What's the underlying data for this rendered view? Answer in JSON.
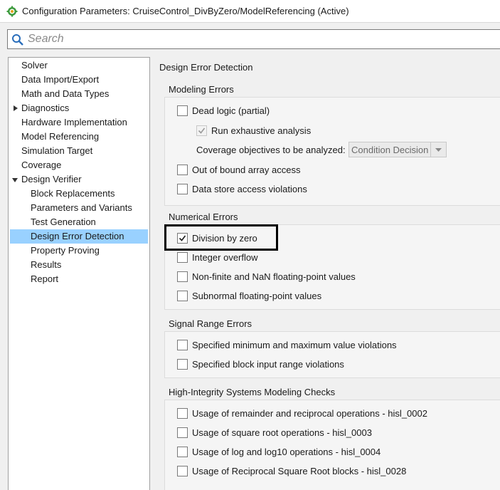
{
  "window": {
    "title": "Configuration Parameters: CruiseControl_DivByZero/ModelReferencing (Active)",
    "icon": "simulink-gear-icon"
  },
  "search": {
    "placeholder": "Search",
    "value": ""
  },
  "tree": {
    "items": [
      {
        "label": "Solver"
      },
      {
        "label": "Data Import/Export"
      },
      {
        "label": "Math and Data Types"
      },
      {
        "label": "Diagnostics",
        "expander": "collapsed"
      },
      {
        "label": "Hardware Implementation"
      },
      {
        "label": "Model Referencing"
      },
      {
        "label": "Simulation Target"
      },
      {
        "label": "Coverage"
      },
      {
        "label": "Design Verifier",
        "expander": "expanded"
      },
      {
        "label": "Block Replacements"
      },
      {
        "label": "Parameters and Variants"
      },
      {
        "label": "Test Generation"
      },
      {
        "label": "Design Error Detection",
        "selected": true
      },
      {
        "label": "Property Proving"
      },
      {
        "label": "Results"
      },
      {
        "label": "Report"
      }
    ]
  },
  "panel": {
    "heading": "Design Error Detection",
    "modeling_errors": {
      "title": "Modeling Errors",
      "dead_logic": {
        "label": "Dead logic (partial)",
        "checked": false
      },
      "run_exhaustive": {
        "label": "Run exhaustive analysis",
        "checked": true,
        "enabled": false
      },
      "coverage_objectives": {
        "label": "Coverage objectives to be analyzed:",
        "value": "Condition Decision",
        "enabled": false
      },
      "out_of_bound": {
        "label": "Out of bound array access",
        "checked": false
      },
      "data_store": {
        "label": "Data store access violations",
        "checked": false
      }
    },
    "numerical_errors": {
      "title": "Numerical Errors",
      "division_by_zero": {
        "label": "Division by zero",
        "checked": true
      },
      "integer_overflow": {
        "label": "Integer overflow",
        "checked": false
      },
      "non_finite": {
        "label": "Non-finite and NaN floating-point values",
        "checked": false
      },
      "subnormal": {
        "label": "Subnormal floating-point values",
        "checked": false
      }
    },
    "signal_range_errors": {
      "title": "Signal Range Errors",
      "min_max": {
        "label": "Specified minimum and maximum value violations",
        "checked": false
      },
      "block_input": {
        "label": "Specified block input range violations",
        "checked": false
      }
    },
    "high_integrity": {
      "title": "High-Integrity Systems Modeling Checks",
      "hisl_0002": {
        "label": "Usage of remainder and reciprocal operations - hisl_0002",
        "checked": false
      },
      "hisl_0003": {
        "label": "Usage of square root operations - hisl_0003",
        "checked": false
      },
      "hisl_0004": {
        "label": "Usage of log and log10 operations - hisl_0004",
        "checked": false
      },
      "hisl_0028": {
        "label": "Usage of Reciprocal Square Root blocks - hisl_0028",
        "checked": false
      }
    }
  },
  "colors": {
    "selection": "#99d1ff",
    "highlight_outline": "#000000"
  }
}
